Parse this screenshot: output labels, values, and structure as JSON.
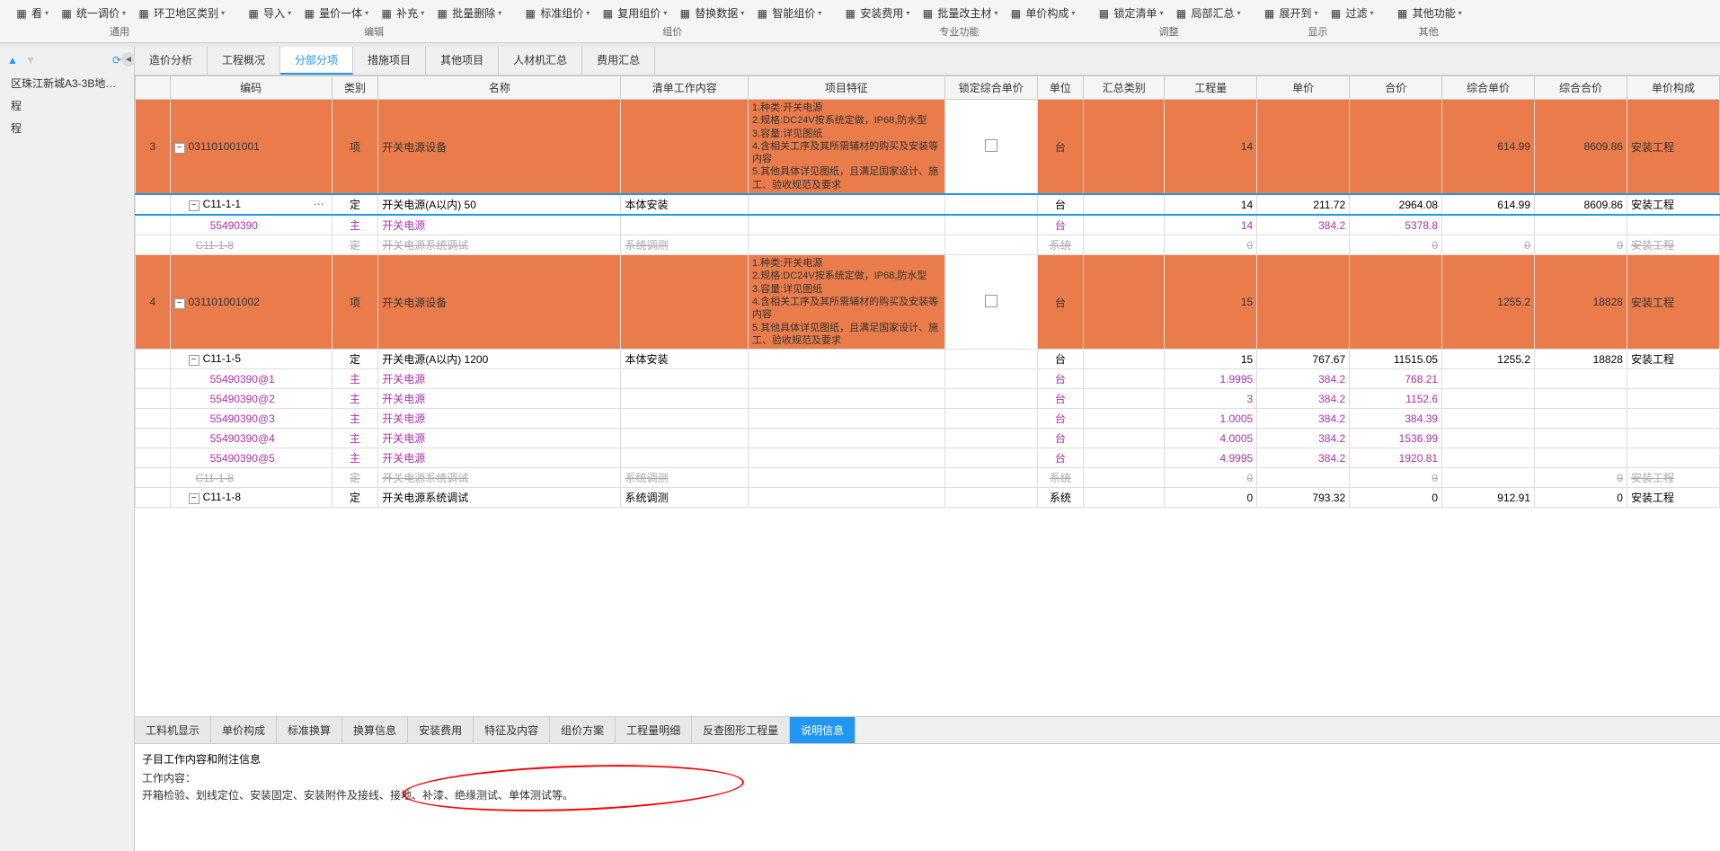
{
  "toolbar": {
    "groups": [
      {
        "label": "通用",
        "buttons": [
          "看",
          "统一调价",
          "环卫地区类别"
        ]
      },
      {
        "label": "编辑",
        "buttons": [
          "导入",
          "量价一体",
          "补充",
          "批量删除"
        ]
      },
      {
        "label": "组价",
        "buttons": [
          "标准组价",
          "复用组价",
          "替换数据",
          "智能组价"
        ]
      },
      {
        "label": "专业功能",
        "buttons": [
          "安装费用",
          "批量改主材",
          "单价构成"
        ]
      },
      {
        "label": "调整",
        "buttons": [
          "锁定清单",
          "局部汇总"
        ]
      },
      {
        "label": "显示",
        "buttons": [
          "展开到",
          "过滤"
        ]
      },
      {
        "label": "其他",
        "buttons": [
          "其他功能"
        ]
      }
    ]
  },
  "sidebar": {
    "items": [
      "区珠江新城A3-3B地块...",
      "程",
      "程"
    ]
  },
  "tabs": [
    "造价分析",
    "工程概况",
    "分部分项",
    "措施项目",
    "其他项目",
    "人材机汇总",
    "费用汇总"
  ],
  "activeTab": 2,
  "columns": [
    "",
    "编码",
    "类别",
    "名称",
    "清单工作内容",
    "项目特征",
    "锁定综合单价",
    "单位",
    "汇总类别",
    "工程量",
    "单价",
    "合价",
    "综合单价",
    "综合合价",
    "单价构成"
  ],
  "feature_text": "1.种类:开关电源\n2.规格:DC24V按系统定做，IP68,防水型\n3.容量:详见图纸\n4.含相关工序及其所需辅材的购买及安装等内容\n5.其他具体详见图纸，且满足国家设计、施工、验收规范及要求",
  "rows": [
    {
      "type": "orange",
      "idx": "3",
      "code": "031101001001",
      "cat": "项",
      "name": "开关电源设备",
      "feat": true,
      "lock": true,
      "unit": "台",
      "qty": "14",
      "price": "",
      "total": "",
      "cprice": "614.99",
      "ctotal": "8609.86",
      "comp": "安装工程"
    },
    {
      "type": "selected",
      "code": "C11-1-1",
      "cat": "定",
      "name": "开关电源(A以内) 50",
      "work": "本体安装",
      "unit": "台",
      "qty": "14",
      "price": "211.72",
      "total": "2964.08",
      "cprice": "614.99",
      "ctotal": "8609.86",
      "comp": "安装工程",
      "more": true,
      "indent": 1
    },
    {
      "type": "purple",
      "code": "55490390",
      "cat": "主",
      "name": "开关电源",
      "unit": "台",
      "qty": "14",
      "price": "384.2",
      "total": "5378.8",
      "indent": 2
    },
    {
      "type": "gray",
      "code": "C11-1-8",
      "cat": "定",
      "name": "开关电源系统调试",
      "work": "系统调测",
      "unit": "系统",
      "qty": "0",
      "price": "",
      "total": "0",
      "cprice": "0",
      "ctotal": "0",
      "comp": "安装工程",
      "indent": 1
    },
    {
      "type": "orange",
      "idx": "4",
      "code": "031101001002",
      "cat": "项",
      "name": "开关电源设备",
      "feat": true,
      "lock": true,
      "unit": "台",
      "qty": "15",
      "price": "",
      "total": "",
      "cprice": "1255.2",
      "ctotal": "18828",
      "comp": "安装工程"
    },
    {
      "type": "normal",
      "code": "C11-1-5",
      "cat": "定",
      "name": "开关电源(A以内) 1200",
      "work": "本体安装",
      "unit": "台",
      "qty": "15",
      "price": "767.67",
      "total": "11515.05",
      "cprice": "1255.2",
      "ctotal": "18828",
      "comp": "安装工程",
      "indent": 1
    },
    {
      "type": "purple",
      "code": "55490390@1",
      "cat": "主",
      "name": "开关电源",
      "unit": "台",
      "qty": "1.9995",
      "price": "384.2",
      "total": "768.21",
      "indent": 2
    },
    {
      "type": "purple",
      "code": "55490390@2",
      "cat": "主",
      "name": "开关电源",
      "unit": "台",
      "qty": "3",
      "price": "384.2",
      "total": "1152.6",
      "indent": 2
    },
    {
      "type": "purple",
      "code": "55490390@3",
      "cat": "主",
      "name": "开关电源",
      "unit": "台",
      "qty": "1.0005",
      "price": "384.2",
      "total": "384.39",
      "indent": 2
    },
    {
      "type": "purple",
      "code": "55490390@4",
      "cat": "主",
      "name": "开关电源",
      "unit": "台",
      "qty": "4.0005",
      "price": "384.2",
      "total": "1536.99",
      "indent": 2
    },
    {
      "type": "purple",
      "code": "55490390@5",
      "cat": "主",
      "name": "开关电源",
      "unit": "台",
      "qty": "4.9995",
      "price": "384.2",
      "total": "1920.81",
      "indent": 2
    },
    {
      "type": "gray",
      "code": "C11-1-8",
      "cat": "定",
      "name": "开关电源系统调试",
      "work": "系统调测",
      "unit": "系统",
      "qty": "0",
      "price": "",
      "total": "0",
      "cprice": "",
      "ctotal": "0",
      "comp": "安装工程",
      "indent": 1
    },
    {
      "type": "normal",
      "code": "C11-1-8",
      "cat": "定",
      "name": "开关电源系统调试",
      "work": "系统调测",
      "unit": "系统",
      "qty": "0",
      "price": "793.32",
      "total": "0",
      "cprice": "912.91",
      "ctotal": "0",
      "comp": "安装工程",
      "indent": 1
    }
  ],
  "bottomTabs": [
    "工料机显示",
    "单价构成",
    "标准换算",
    "换算信息",
    "安装费用",
    "特征及内容",
    "组价方案",
    "工程量明细",
    "反查图形工程量",
    "说明信息"
  ],
  "bottomActiveTab": 9,
  "bottomPanel": {
    "title": "子目工作内容和附注信息",
    "content_label": "工作内容：",
    "content_text": "开箱检验、划线定位、安装固定、安装附件及接线、接地、补漆、绝缘测试、单体测试等。"
  }
}
